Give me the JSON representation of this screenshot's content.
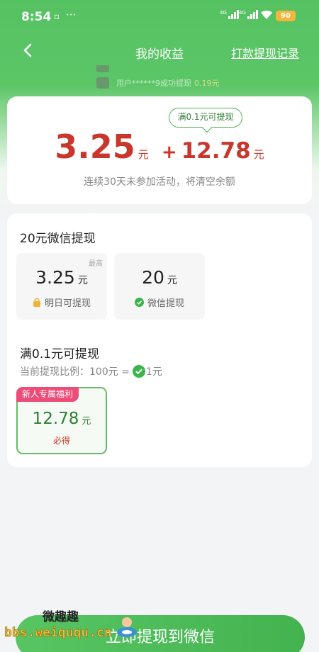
{
  "status_bar": {
    "time": "8:54",
    "net1": "4G",
    "net2": "4G",
    "battery": "90"
  },
  "nav": {
    "title": "我的收益",
    "record_link": "打款提现记录"
  },
  "ticker": {
    "row1_text": "用户******9成功提现",
    "row1_amount": "0.19元"
  },
  "balance": {
    "bubble": "满0.1元可提现",
    "amount_main": "3.25",
    "unit_main": "元",
    "plus": "+",
    "amount_bonus": "12.78",
    "unit_bonus": "元",
    "notice": "连续30天未参加活动，将清空余额"
  },
  "wechat_section": {
    "title": "20元微信提现",
    "option1": {
      "tag": "最高",
      "value": "3.25",
      "unit": "元",
      "sub": "明日可提现"
    },
    "option2": {
      "value": "20",
      "unit": "元",
      "sub": "微信提现"
    }
  },
  "small_section": {
    "title": "满0.1元可提现",
    "ratio_prefix": "当前提现比例：100元 =",
    "ratio_suffix": "1元",
    "newcomer": {
      "badge": "新人专属福利",
      "value": "12.78",
      "unit": "元",
      "note": "必得"
    }
  },
  "cta_label": "立即提现到微信",
  "watermark": {
    "line1": "微趣趣",
    "line2": "bbs.weiququ.cn"
  },
  "colors": {
    "brand_green": "#55c262",
    "amount_red": "#c9372c",
    "badge_pink": "#ec4c78"
  }
}
